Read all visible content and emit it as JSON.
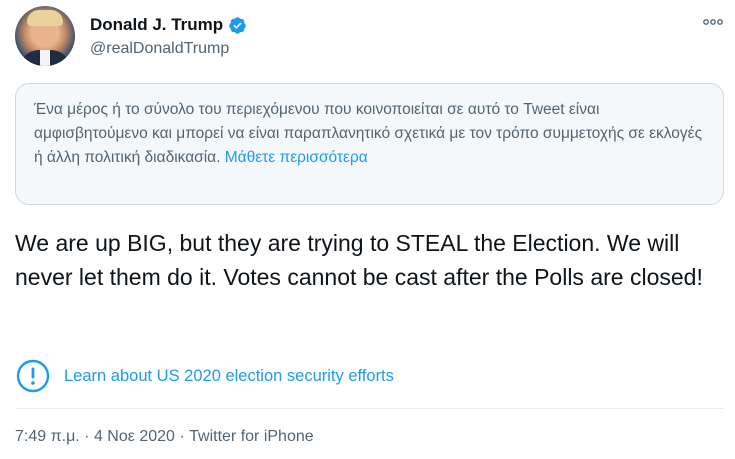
{
  "author": {
    "name": "Donald J. Trump",
    "handle": "@realDonaldTrump"
  },
  "notice": {
    "text": "Ένα μέρος ή το σύνολο του περιεχόμενου που κοινοποιείται σε αυτό το Tweet είναι αμφισβητούμενο και μπορεί να είναι παραπλανητικό σχετικά με τον τρόπο συμμετοχής σε εκλογές ή άλλη πολιτική διαδικασία.",
    "link": "Μάθετε περισσότερα"
  },
  "tweet": {
    "text": "We are up BIG, but they are trying to STEAL the Election. We will never let them do it. Votes cannot be cast after the Polls are closed!"
  },
  "learn_link": "Learn about US 2020 election security efforts",
  "meta": "7:49 π.μ. · 4 Νοε 2020 · Twitter for iPhone",
  "colors": {
    "accent": "#1d9bf0",
    "secondary_text": "#536471",
    "notice_bg": "#f5f8fa"
  },
  "icons": {
    "verified": "verified-badge-icon",
    "more": "more-dots-icon",
    "learn": "exclamation-circle-icon"
  }
}
